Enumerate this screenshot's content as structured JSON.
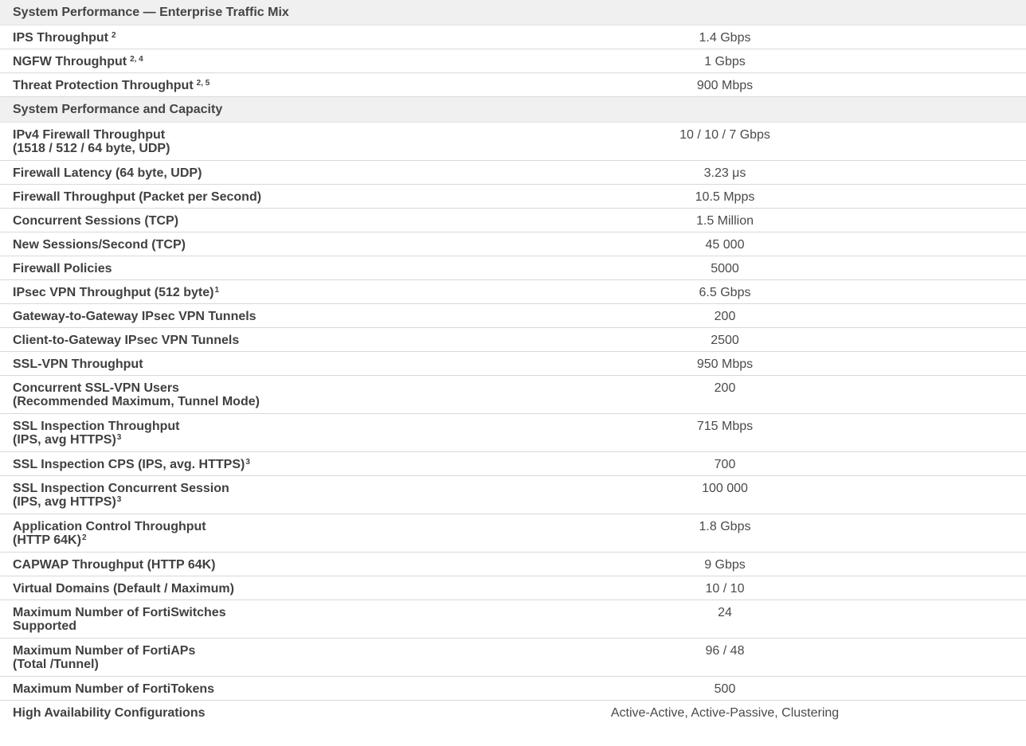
{
  "sections": [
    {
      "title": "System Performance — Enterprise Traffic Mix",
      "rows": [
        {
          "label": "IPS Throughput",
          "sup": "2",
          "value": "1.4 Gbps"
        },
        {
          "label": "NGFW Throughput",
          "sup": "2, 4",
          "value": "1 Gbps"
        },
        {
          "label": "Threat Protection Throughput",
          "sup": "2, 5",
          "value": "900 Mbps"
        }
      ]
    },
    {
      "title": "System Performance and Capacity",
      "rows": [
        {
          "label": "IPv4 Firewall Throughput",
          "label2": "(1518 / 512 / 64 byte, UDP)",
          "value": "10 / 10 / 7 Gbps"
        },
        {
          "label": "Firewall Latency (64 byte, UDP)",
          "value": "3.23 μs"
        },
        {
          "label": "Firewall Throughput (Packet per Second)",
          "value": "10.5 Mpps"
        },
        {
          "label": "Concurrent Sessions (TCP)",
          "value": "1.5 Million"
        },
        {
          "label": "New Sessions/Second (TCP)",
          "value": "45 000"
        },
        {
          "label": "Firewall Policies",
          "value": "5000"
        },
        {
          "label": "IPsec VPN Throughput (512 byte)",
          "sup": "1",
          "value": "6.5 Gbps"
        },
        {
          "label": "Gateway-to-Gateway IPsec VPN Tunnels",
          "value": "200"
        },
        {
          "label": "Client-to-Gateway IPsec VPN Tunnels",
          "value": "2500"
        },
        {
          "label": "SSL-VPN Throughput",
          "value": "950 Mbps"
        },
        {
          "label": "Concurrent SSL-VPN Users",
          "label2": "(Recommended Maximum, Tunnel Mode)",
          "value": "200"
        },
        {
          "label": "SSL Inspection Throughput",
          "label2": "(IPS, avg HTTPS)",
          "sup2": "3",
          "value": "715 Mbps"
        },
        {
          "label": "SSL Inspection CPS (IPS, avg. HTTPS)",
          "sup": "3",
          "value": "700"
        },
        {
          "label": "SSL Inspection Concurrent Session",
          "label2": "(IPS, avg HTTPS)",
          "sup2": "3",
          "value": "100 000"
        },
        {
          "label": "Application Control Throughput",
          "label2": "(HTTP 64K)",
          "sup2": "2",
          "value": "1.8 Gbps"
        },
        {
          "label": "CAPWAP Throughput (HTTP 64K)",
          "value": "9 Gbps"
        },
        {
          "label": "Virtual Domains (Default / Maximum)",
          "value": "10 / 10"
        },
        {
          "label": "Maximum Number of FortiSwitches",
          "label2": "Supported",
          "value": "24"
        },
        {
          "label": "Maximum Number of FortiAPs",
          "label2": "(Total /Tunnel)",
          "value": "96 / 48"
        },
        {
          "label": "Maximum Number of FortiTokens",
          "value": "500"
        },
        {
          "label": "High Availability Configurations",
          "value": "Active-Active, Active-Passive, Clustering"
        }
      ]
    }
  ]
}
